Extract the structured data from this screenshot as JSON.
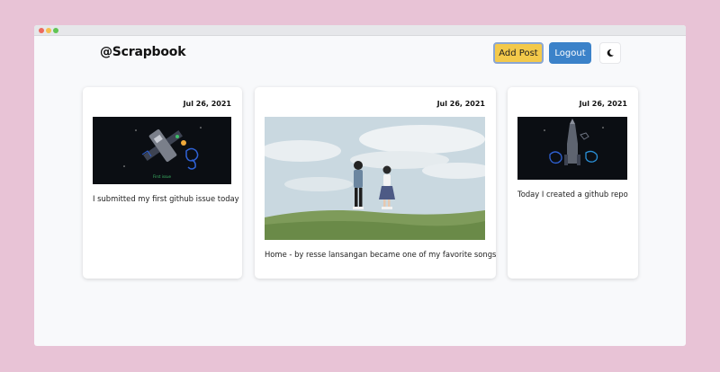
{
  "app": {
    "brand": "@Scrapbook"
  },
  "colors": {
    "page_background": "#e8c3d6",
    "dot_red": "#ed6a5e",
    "dot_yellow": "#f5bf4f",
    "dot_green": "#61c554",
    "add_button": "#f3c94a",
    "logout_button": "#3b82c9"
  },
  "header": {
    "add_post_label": "Add Post",
    "logout_label": "Logout",
    "theme_toggle_icon": "moon-icon"
  },
  "posts": [
    {
      "date": "Jul 26, 2021",
      "caption": "I submitted my first github issue today",
      "image": "space-illustration",
      "image_caption": "First issue"
    },
    {
      "date": "Jul 26, 2021",
      "caption": "Home - by resse lansangan became one of my favorite songs",
      "image": "couple-on-hill-illustration"
    },
    {
      "date": "Jul 26, 2021",
      "caption": "Today I created a github repo",
      "image": "rocket-illustration"
    }
  ]
}
